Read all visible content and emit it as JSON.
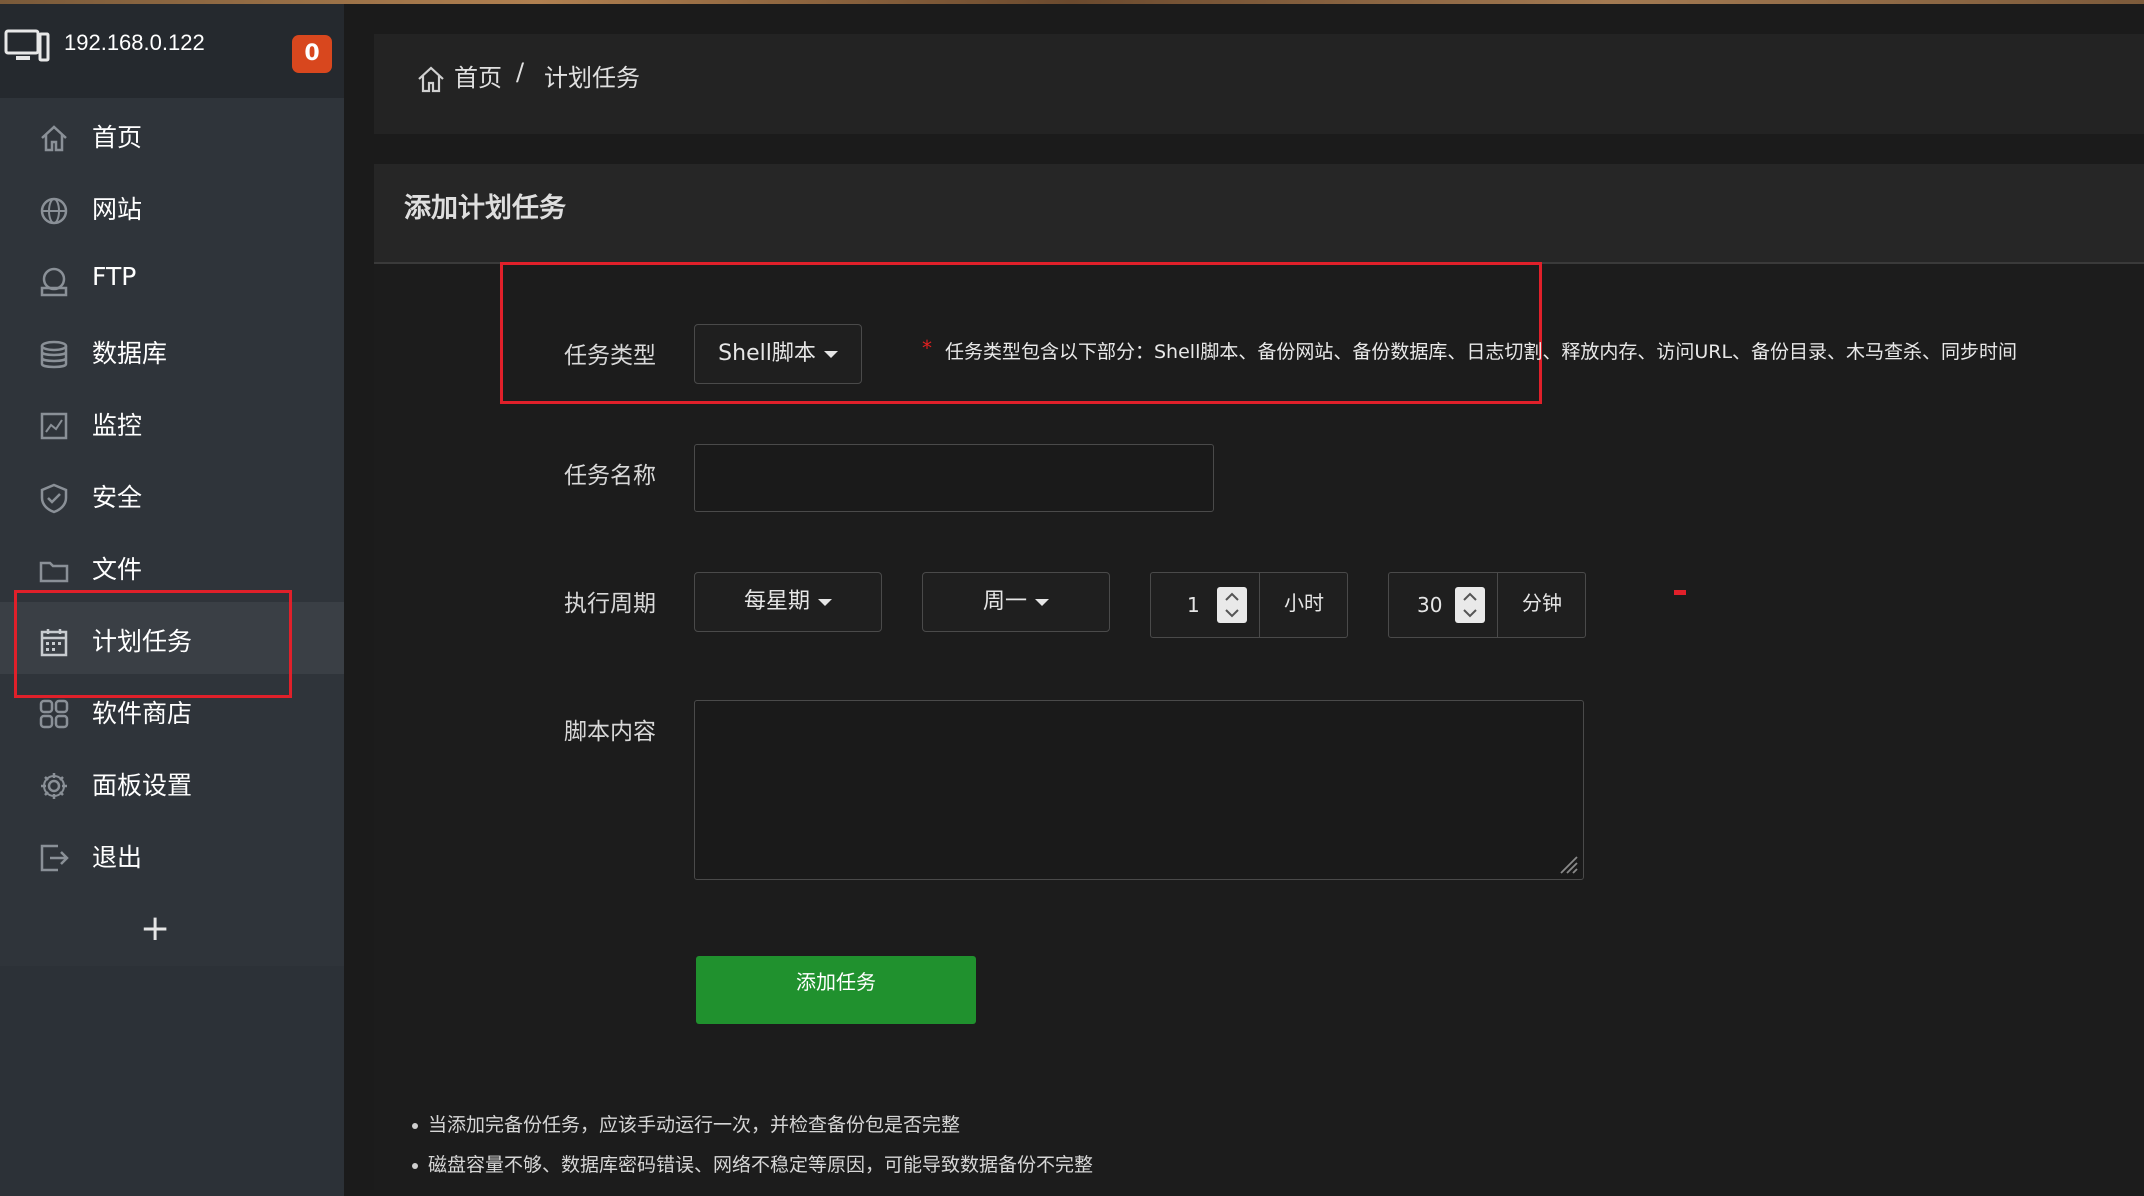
{
  "sidebar": {
    "host": "192.168.0.122",
    "badge": "0",
    "items": [
      {
        "label": "首页",
        "icon": "home-icon"
      },
      {
        "label": "网站",
        "icon": "globe-icon"
      },
      {
        "label": "FTP",
        "icon": "ftp-icon"
      },
      {
        "label": "数据库",
        "icon": "database-icon"
      },
      {
        "label": "监控",
        "icon": "monitor-chart-icon"
      },
      {
        "label": "安全",
        "icon": "shield-icon"
      },
      {
        "label": "文件",
        "icon": "folder-icon"
      },
      {
        "label": "计划任务",
        "icon": "calendar-icon"
      },
      {
        "label": "软件商店",
        "icon": "apps-grid-icon"
      },
      {
        "label": "面板设置",
        "icon": "gear-icon"
      },
      {
        "label": "退出",
        "icon": "logout-icon"
      }
    ],
    "active_index": 7,
    "add_label": "+"
  },
  "breadcrumb": {
    "home": "首页",
    "separator": "/",
    "current": "计划任务"
  },
  "panel": {
    "title": "添加计划任务"
  },
  "form": {
    "task_type_label": "任务类型",
    "task_type_value": "Shell脚本",
    "task_type_required": "*",
    "task_type_hint": "任务类型包含以下部分：Shell脚本、备份网站、备份数据库、日志切割、释放内存、访问URL、备份目录、木马查杀、同步时间",
    "task_name_label": "任务名称",
    "task_name_value": "",
    "period_label": "执行周期",
    "period_value": "每星期",
    "weekday_value": "周一",
    "hour_value": "1",
    "hour_unit": "小时",
    "minute_value": "30",
    "minute_unit": "分钟",
    "script_label": "脚本内容",
    "script_value": "",
    "submit_label": "添加任务"
  },
  "tips": [
    "当添加完备份任务，应该手动运行一次，并检查备份包是否完整",
    "磁盘容量不够、数据库密码错误、网络不稳定等原因，可能导致数据备份不完整"
  ],
  "colors": {
    "sidebar_bg": "#2f343a",
    "badge": "#d8471e",
    "submit": "#20912e",
    "highlight_box": "#e0202a"
  }
}
